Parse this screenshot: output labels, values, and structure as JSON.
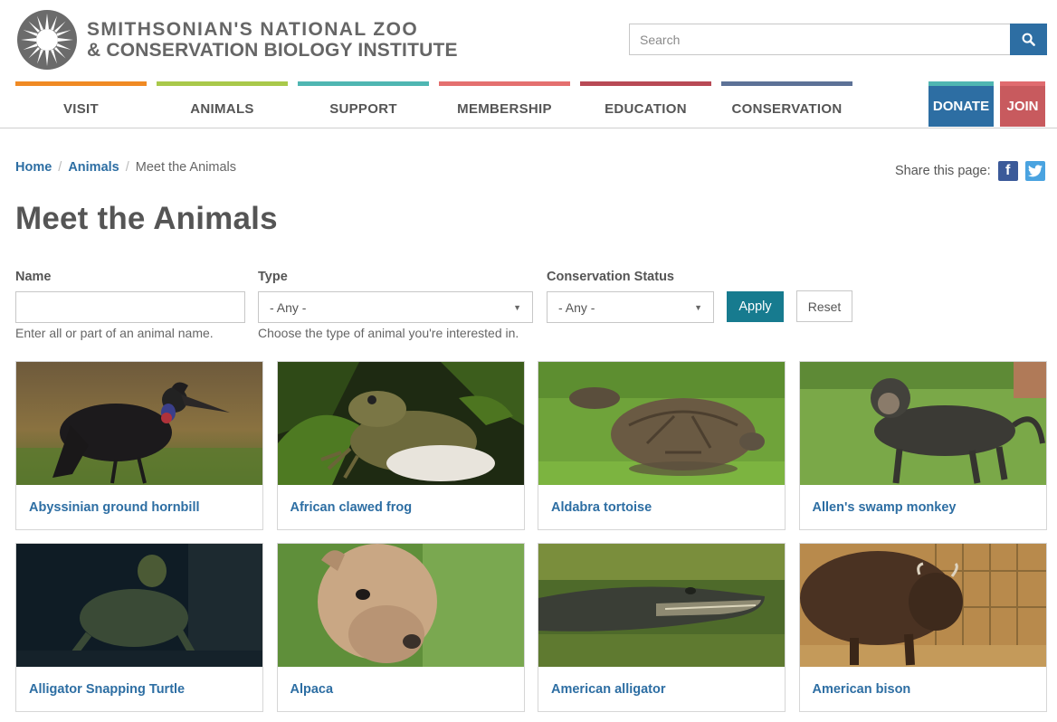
{
  "header": {
    "logo_line1": "SMITHSONIAN'S NATIONAL ZOO",
    "logo_line2": "& CONSERVATION BIOLOGY INSTITUTE",
    "search_placeholder": "Search"
  },
  "nav": [
    {
      "label": "VISIT",
      "color": "#f08a24"
    },
    {
      "label": "ANIMALS",
      "color": "#a9c94b"
    },
    {
      "label": "SUPPORT",
      "color": "#4fb6b2"
    },
    {
      "label": "MEMBERSHIP",
      "color": "#e4706f"
    },
    {
      "label": "EDUCATION",
      "color": "#b84a55"
    },
    {
      "label": "CONSERVATION",
      "color": "#5d7297"
    }
  ],
  "cta": {
    "donate": "DONATE",
    "join": "JOIN"
  },
  "breadcrumb": {
    "home": "Home",
    "sep": "/",
    "animals": "Animals",
    "current": "Meet the Animals"
  },
  "share": {
    "label": "Share this page:",
    "facebook": "f"
  },
  "page_title": "Meet the Animals",
  "filters": {
    "name_label": "Name",
    "name_value": "",
    "name_help": "Enter all or part of an animal name.",
    "type_label": "Type",
    "type_value": "- Any -",
    "type_help": "Choose the type of animal you're interested in.",
    "status_label": "Conservation Status",
    "status_value": "- Any -",
    "apply": "Apply",
    "reset": "Reset"
  },
  "animals": [
    {
      "name": "Abyssinian ground hornbill",
      "icon": "hornbill-photo"
    },
    {
      "name": "African clawed frog",
      "icon": "frog-photo"
    },
    {
      "name": "Aldabra tortoise",
      "icon": "tortoise-photo"
    },
    {
      "name": "Allen's swamp monkey",
      "icon": "monkey-photo"
    },
    {
      "name": "Alligator Snapping Turtle",
      "icon": "turtle-photo"
    },
    {
      "name": "Alpaca",
      "icon": "alpaca-photo"
    },
    {
      "name": "American alligator",
      "icon": "alligator-photo"
    },
    {
      "name": "American bison",
      "icon": "bison-photo"
    }
  ]
}
